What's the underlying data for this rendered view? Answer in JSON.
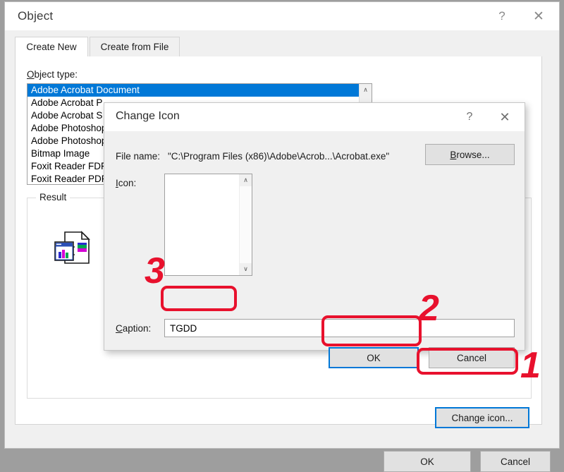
{
  "object_window": {
    "title": "Object",
    "help_label": "?",
    "close_label": "✕",
    "tabs": [
      {
        "label": "Create New",
        "active": true
      },
      {
        "label": "Create from File",
        "active": false
      }
    ],
    "object_type_label": "Object type:",
    "object_types": [
      {
        "label": "Adobe Acrobat Document",
        "selected": true
      },
      {
        "label": "Adobe Acrobat P",
        "selected": false
      },
      {
        "label": "Adobe Acrobat S",
        "selected": false
      },
      {
        "label": "Adobe Photoshop",
        "selected": false
      },
      {
        "label": "Adobe Photoshop",
        "selected": false
      },
      {
        "label": "Bitmap Image",
        "selected": false
      },
      {
        "label": "Foxit Reader FDF",
        "selected": false
      },
      {
        "label": "Foxit Reader PDF",
        "selected": false
      }
    ],
    "scroll_up_glyph": "∧",
    "result_legend": "Result",
    "change_icon_button": "Change icon...",
    "ok_button": "OK",
    "cancel_button": "Cancel"
  },
  "change_icon_dialog": {
    "title": "Change Icon",
    "help_label": "?",
    "close_label": "✕",
    "file_name_label": "File name:",
    "file_name_value": "\"C:\\Program Files (x86)\\Adobe\\Acrob...\\Acrobat.exe\"",
    "browse_button": "Browse...",
    "icon_label": "Icon:",
    "icon_list_items": [],
    "scroll_up_glyph": "∧",
    "scroll_down_glyph": "∨",
    "caption_label": "Caption:",
    "caption_value": "TGDD",
    "caption_placeholder": "",
    "ok_button": "OK",
    "cancel_button": "Cancel"
  },
  "annotations": {
    "step1": "1",
    "step2": "2",
    "step3": "3",
    "color": "#e8112d"
  },
  "colors": {
    "selection_blue": "#0078d7",
    "dialog_bg": "#f0f0f0",
    "button_bg": "#e1e1e1",
    "annotation_red": "#e8112d"
  }
}
